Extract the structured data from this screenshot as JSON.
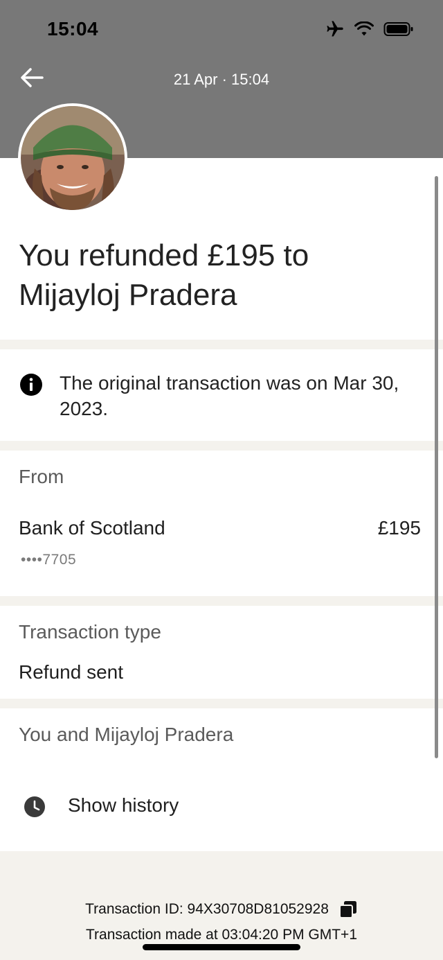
{
  "status": {
    "time": "15:04"
  },
  "header": {
    "datetime": "21 Apr · 15:04",
    "back_icon": "arrow-left-icon"
  },
  "hero": {
    "title": "You refunded £195 to Mijayloj Pradera"
  },
  "info": {
    "text": "The original transaction was on Mar 30, 2023."
  },
  "from": {
    "label": "From",
    "bank": "Bank of Scotland",
    "amount": "£195",
    "masked": "••••7705"
  },
  "transaction_type": {
    "label": "Transaction type",
    "value": "Refund sent"
  },
  "history": {
    "heading": "You and Mijayloj Pradera",
    "button_label": "Show history"
  },
  "footer": {
    "transaction_id": "Transaction ID: 94X30708D81052928",
    "made_at": "Transaction made at 03:04:20 PM GMT+1"
  },
  "colors": {
    "header_bg": "#787878",
    "page_bg": "#f4f2ed",
    "card_bg": "#ffffff"
  }
}
